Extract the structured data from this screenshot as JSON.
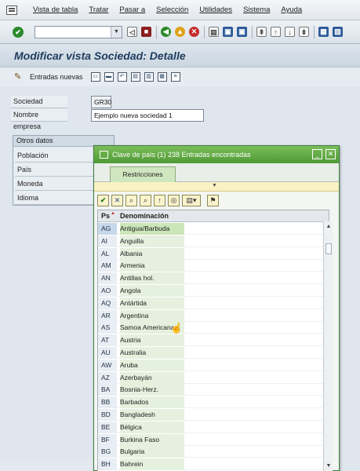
{
  "menubar": {
    "items": [
      "Vista de tabla",
      "Tratar",
      "Pasar a",
      "Selección",
      "Utilidades",
      "Sistema",
      "Ayuda"
    ]
  },
  "toolbar": {
    "command_value": "",
    "icons": [
      "enter-icon",
      "back-icon",
      "save-icon",
      "green-back-icon",
      "exit-icon",
      "cancel-icon",
      "print-icon",
      "find-icon",
      "find-next-icon",
      "first-page-icon",
      "prev-page-icon",
      "next-page-icon",
      "last-page-icon",
      "new-session-icon",
      "shortcut-icon"
    ]
  },
  "title": "Modificar vista Sociedad: Detalle",
  "apptoolbar": {
    "label": "Entradas nuevas"
  },
  "form": {
    "sociedad_label": "Sociedad",
    "sociedad_value": "GR30",
    "nombre_label": "Nombre empresa",
    "nombre_value": "Ejemplo nueva sociedad 1",
    "group_title": "Otros datos",
    "fields": [
      {
        "label": "Población"
      },
      {
        "label": "País"
      },
      {
        "label": "Moneda"
      },
      {
        "label": "Idioma"
      }
    ]
  },
  "popup": {
    "title": "Clave de país (1)  238 Entradas encontradas",
    "tab_label": "Restricciones",
    "columns": {
      "code": "Ps",
      "name": "Denominación"
    },
    "rows": [
      {
        "code": "AG",
        "name": "Antigua/Barbuda"
      },
      {
        "code": "AI",
        "name": "Anguilla"
      },
      {
        "code": "AL",
        "name": "Albania"
      },
      {
        "code": "AM",
        "name": "Armenia"
      },
      {
        "code": "AN",
        "name": "Antillas hol."
      },
      {
        "code": "AO",
        "name": "Angola"
      },
      {
        "code": "AQ",
        "name": "Antártida"
      },
      {
        "code": "AR",
        "name": "Argentina"
      },
      {
        "code": "AS",
        "name": "Samoa Americana"
      },
      {
        "code": "AT",
        "name": "Austria"
      },
      {
        "code": "AU",
        "name": "Australia"
      },
      {
        "code": "AW",
        "name": "Aruba"
      },
      {
        "code": "AZ",
        "name": "Azerbayán"
      },
      {
        "code": "BA",
        "name": "Bosnia-Herz."
      },
      {
        "code": "BB",
        "name": "Barbados"
      },
      {
        "code": "BD",
        "name": "Bangladesh"
      },
      {
        "code": "BE",
        "name": "Bélgica"
      },
      {
        "code": "BF",
        "name": "Burkina Faso"
      },
      {
        "code": "BG",
        "name": "Bulgaria"
      },
      {
        "code": "BH",
        "name": "Bahrein"
      }
    ]
  },
  "colors": {
    "popup_title_bg": "#5aa53f",
    "header_blue": "#1d3a5e"
  }
}
